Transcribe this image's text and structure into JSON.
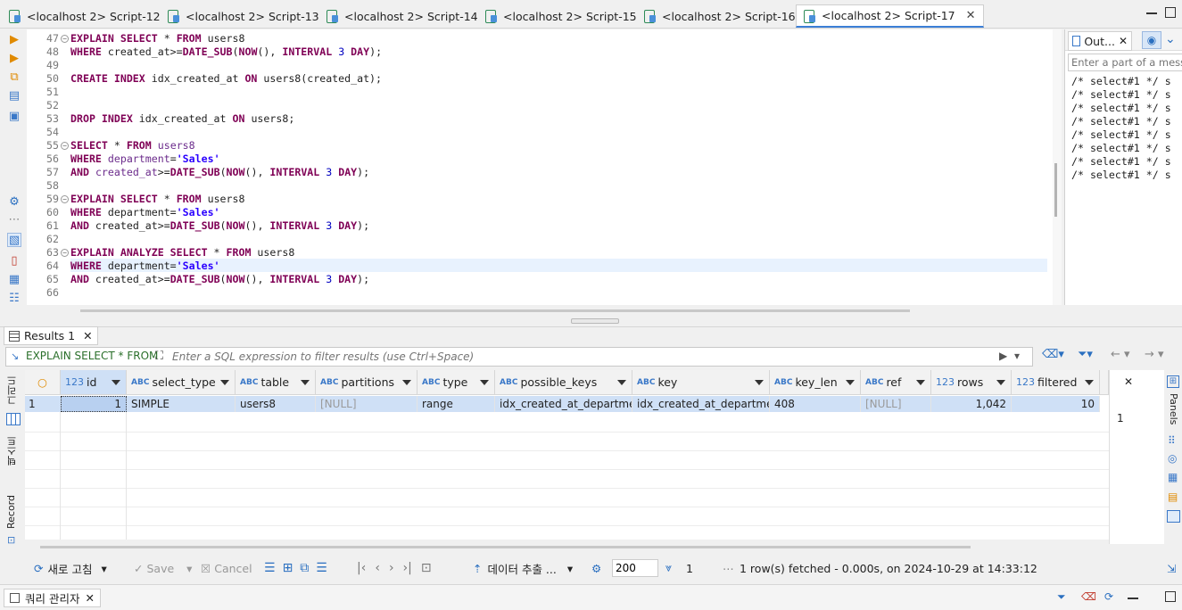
{
  "tabs": [
    {
      "label": "<localhost 2> Script-12"
    },
    {
      "label": "<localhost 2> Script-13"
    },
    {
      "label": "<localhost 2> Script-14"
    },
    {
      "label": "<localhost 2> Script-15"
    },
    {
      "label": "<localhost 2> Script-16"
    },
    {
      "label": "<localhost 2> Script-17",
      "active": true
    }
  ],
  "editor": {
    "lines": [
      {
        "n": "47",
        "fold": true
      },
      {
        "n": "48"
      },
      {
        "n": "49"
      },
      {
        "n": "50"
      },
      {
        "n": "51"
      },
      {
        "n": "52"
      },
      {
        "n": "53"
      },
      {
        "n": "54"
      },
      {
        "n": "55",
        "fold": true
      },
      {
        "n": "56"
      },
      {
        "n": "57"
      },
      {
        "n": "58"
      },
      {
        "n": "59",
        "fold": true
      },
      {
        "n": "60"
      },
      {
        "n": "61"
      },
      {
        "n": "62"
      },
      {
        "n": "63",
        "fold": true
      },
      {
        "n": "64"
      },
      {
        "n": "65"
      },
      {
        "n": "66"
      }
    ],
    "code": {
      "l47": [
        "EXPLAIN SELECT",
        " * ",
        "FROM",
        " users8"
      ],
      "l48": [
        "WHERE",
        " created_at>=",
        "DATE_SUB",
        "(",
        "NOW",
        "(), ",
        "INTERVAL",
        " ",
        "3",
        " ",
        "DAY",
        ");"
      ],
      "l50": [
        "CREATE INDEX",
        " idx_created_at ",
        "ON",
        " users8(created_at);"
      ],
      "l53": [
        "DROP INDEX",
        " idx_created_at ",
        "ON",
        " users8;"
      ],
      "l55": [
        "SELECT",
        " * ",
        "FROM",
        " ",
        "users8"
      ],
      "l56": [
        "WHERE",
        " ",
        "department",
        "=",
        "'Sales'"
      ],
      "l57": [
        "AND",
        " ",
        "created_at",
        ">=",
        "DATE_SUB",
        "(",
        "NOW",
        "(), ",
        "INTERVAL",
        " ",
        "3",
        " ",
        "DAY",
        ");"
      ],
      "l59": [
        "EXPLAIN SELECT",
        " * ",
        "FROM",
        " users8"
      ],
      "l60": [
        "WHERE",
        " department=",
        "'Sales'"
      ],
      "l61": [
        "AND",
        " created_at>=",
        "DATE_SUB",
        "(",
        "NOW",
        "(), ",
        "INTERVAL",
        " ",
        "3",
        " ",
        "DAY",
        ");"
      ],
      "l63": [
        "EXPLAIN ANALYZE SELECT",
        " * ",
        "FROM",
        " users8"
      ],
      "l64": [
        "WHERE",
        " department=",
        "'Sales'"
      ],
      "l65": [
        "AND",
        " created_at>=",
        "DATE_SUB",
        "(",
        "NOW",
        "(), ",
        "INTERVAL",
        " ",
        "3",
        " ",
        "DAY",
        ");"
      ]
    }
  },
  "outline": {
    "tab_label": "Out...",
    "filter_placeholder": "Enter a part of a message",
    "items": [
      "/* select#1 */ s",
      "/* select#1 */ s",
      "/* select#1 */ s",
      "/* select#1 */ s",
      "/* select#1 */ s",
      "/* select#1 */ s",
      "/* select#1 */ s",
      "/* select#1 */ s"
    ]
  },
  "results": {
    "tab_label": "Results 1",
    "filter_query": "EXPLAIN SELECT * FROM",
    "filter_placeholder": "Enter a SQL expression to filter results (use Ctrl+Space)",
    "columns": [
      {
        "name": "id",
        "type": "123"
      },
      {
        "name": "select_type",
        "type": "ABC"
      },
      {
        "name": "table",
        "type": "ABC"
      },
      {
        "name": "partitions",
        "type": "ABC"
      },
      {
        "name": "type",
        "type": "ABC"
      },
      {
        "name": "possible_keys",
        "type": "ABC"
      },
      {
        "name": "key",
        "type": "ABC"
      },
      {
        "name": "key_len",
        "type": "ABC"
      },
      {
        "name": "ref",
        "type": "ABC"
      },
      {
        "name": "rows",
        "type": "123"
      },
      {
        "name": "filtered",
        "type": "123"
      }
    ],
    "row_number": "1",
    "row": [
      "1",
      "SIMPLE",
      "users8",
      "[NULL]",
      "range",
      "idx_created_at_department",
      "idx_created_at_department",
      "408",
      "[NULL]",
      "1,042",
      "10"
    ],
    "side_labels": {
      "grid": "그리드",
      "text": "텍스트",
      "record": "Record"
    },
    "side_value": "1",
    "panels_label": "Panels"
  },
  "bottom": {
    "refresh": "새로 고침",
    "save": "Save",
    "cancel": "Cancel",
    "export": "데이터 추출 ...",
    "fetch_size": "200",
    "count": "1",
    "status": "1 row(s) fetched - 0.000s, on 2024-10-29 at 14:33:12"
  },
  "query_manager": {
    "label": "쿼리 관리자"
  }
}
